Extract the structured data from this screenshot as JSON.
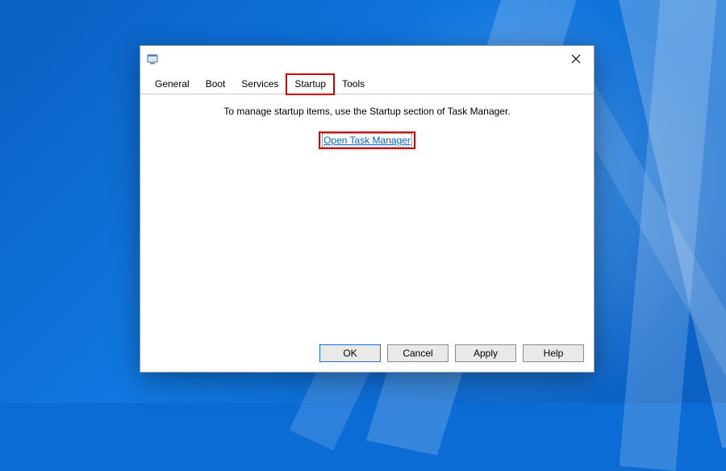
{
  "tabs": {
    "general": "General",
    "boot": "Boot",
    "services": "Services",
    "startup": "Startup",
    "tools": "Tools",
    "active": "Startup"
  },
  "content": {
    "info_text": "To manage startup items, use the Startup section of Task Manager.",
    "link_label": "Open Task Manager"
  },
  "buttons": {
    "ok": "OK",
    "cancel": "Cancel",
    "apply": "Apply",
    "help": "Help"
  }
}
